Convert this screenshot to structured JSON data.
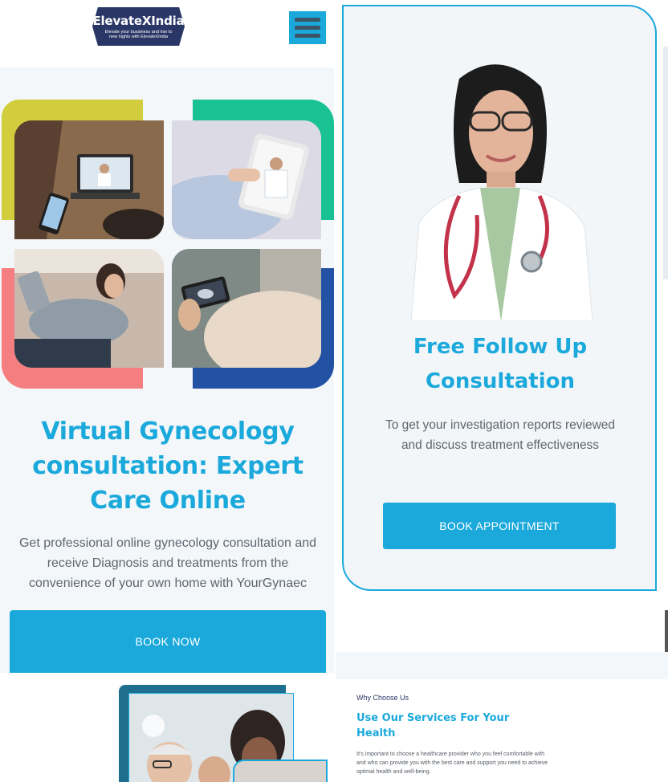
{
  "header": {
    "logo_title": "ElevateXIndia",
    "logo_tagline": "Elevate your bussiness and rise to new hights with ElevateXIndia",
    "menu_icon": "hamburger-menu-icon"
  },
  "hero": {
    "title": "Virtual Gynecology consultation: Expert Care Online",
    "description": "Get professional online gynecology consultation and receive Diagnosis and treatments from the convenience of your own home with YourGynaec",
    "book_button": "BOOK NOW",
    "colors": {
      "yellow": "#d2cd3c",
      "green": "#19c193",
      "pink": "#f57e80",
      "blue": "#2352a5"
    }
  },
  "card": {
    "title": "Free Follow Up Consultation",
    "description": "To get your investigation reports reviewed and discuss treatment effectiveness",
    "button": "BOOK APPOINTMENT"
  },
  "why": {
    "label": "Why Choose Us",
    "title": "Use Our Services For Your Health",
    "text": "It’s important to choose a healthcare provider who you feel comfortable with and who can provide you with the best care and support you need to achieve optimal health and well-being."
  },
  "theme": {
    "accent": "#1ba9dc",
    "navy": "#2a3766",
    "text": "#5d6670"
  }
}
